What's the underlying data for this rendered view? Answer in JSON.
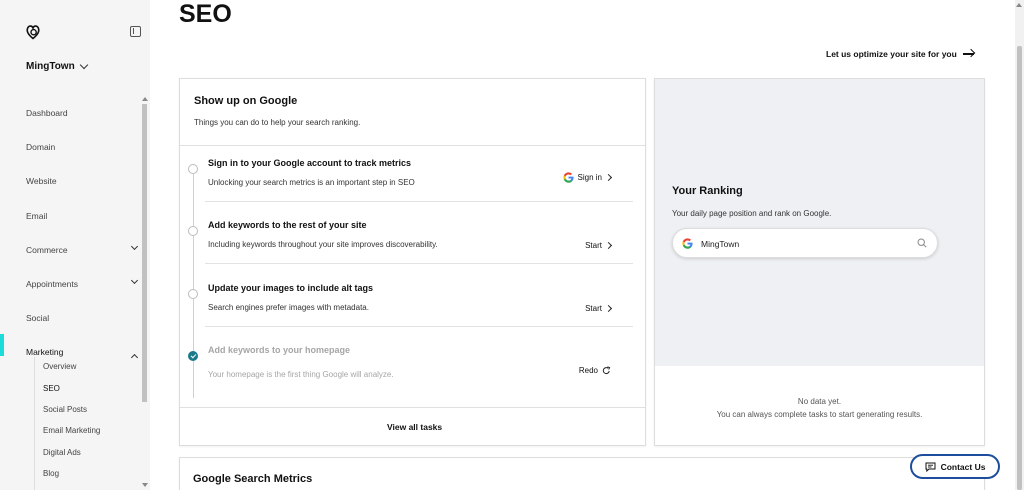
{
  "sidebar": {
    "site_name": "MingTown",
    "nav": [
      {
        "label": "Dashboard",
        "expandable": false
      },
      {
        "label": "Domain",
        "expandable": false
      },
      {
        "label": "Website",
        "expandable": false
      },
      {
        "label": "Email",
        "expandable": false
      },
      {
        "label": "Commerce",
        "expandable": true
      },
      {
        "label": "Appointments",
        "expandable": true
      },
      {
        "label": "Social",
        "expandable": false
      },
      {
        "label": "Marketing",
        "expandable": true,
        "expanded": true
      }
    ],
    "marketing_sub": [
      "Overview",
      "SEO",
      "Social Posts",
      "Email Marketing",
      "Digital Ads",
      "Blog"
    ],
    "accent_color": "#1bdbdb"
  },
  "page": {
    "title": "SEO",
    "optimize_link": "Let us optimize your site for you"
  },
  "google_card": {
    "title": "Show up on Google",
    "subtitle": "Things you can do to help your search ranking.",
    "tasks": [
      {
        "title": "Sign in to your Google account to track metrics",
        "desc": "Unlocking your search metrics is an important step in SEO",
        "action": "Sign in",
        "done": false
      },
      {
        "title": "Add keywords to the rest of your site",
        "desc": "Including keywords throughout your site improves discoverability.",
        "action": "Start",
        "done": false
      },
      {
        "title": "Update your images to include alt tags",
        "desc": "Search engines prefer images with metadata.",
        "action": "Start",
        "done": false
      },
      {
        "title": "Add keywords to your homepage",
        "desc": "Your homepage is the first thing Google will analyze.",
        "action": "Redo",
        "done": true
      }
    ],
    "view_all": "View all tasks"
  },
  "ranking_card": {
    "title": "Your Ranking",
    "subtitle": "Your daily page position and rank on Google.",
    "search_value": "MingTown",
    "empty_line1": "No data yet.",
    "empty_line2": "You can always complete tasks to start generating results."
  },
  "metrics_card": {
    "title": "Google Search Metrics"
  },
  "contact": {
    "label": "Contact Us"
  },
  "colors": {
    "done_check": "#1b7a8b",
    "contact_border": "#1d4e9e"
  }
}
